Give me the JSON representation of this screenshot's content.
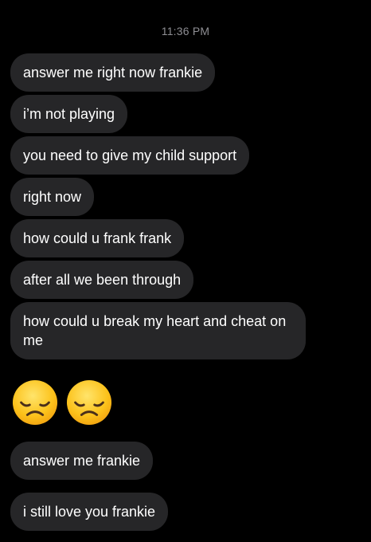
{
  "header": {
    "timestamp": "11:36 PM"
  },
  "messages": [
    {
      "text": "answer me right now frankie"
    },
    {
      "text": "i’m not playing"
    },
    {
      "text": "you need to give my child support"
    },
    {
      "text": "right now"
    },
    {
      "text": "how could u frank frank"
    },
    {
      "text": "after all we been through"
    },
    {
      "text": "how could u break my heart and cheat on me"
    },
    {
      "emoji": "disappointed-face",
      "count": 2
    },
    {
      "text": "answer me frankie"
    },
    {
      "text": "i still love you frankie"
    }
  ],
  "colors": {
    "background": "#000000",
    "bubble": "#262628",
    "timestamp": "#8e8e93",
    "text": "#ffffff"
  }
}
